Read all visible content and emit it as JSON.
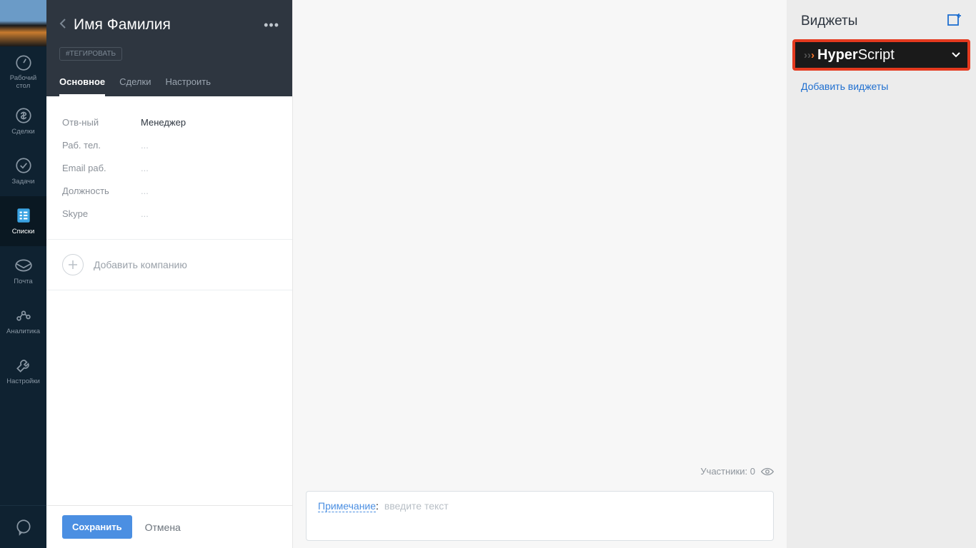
{
  "nav": {
    "items": [
      {
        "label": "Рабочий\nстол",
        "icon": "gauge"
      },
      {
        "label": "Сделки",
        "icon": "dollar"
      },
      {
        "label": "Задачи",
        "icon": "check"
      },
      {
        "label": "Списки",
        "icon": "list"
      },
      {
        "label": "Почта",
        "icon": "mail"
      },
      {
        "label": "Аналитика",
        "icon": "analytics"
      },
      {
        "label": "Настройки",
        "icon": "wrench"
      }
    ]
  },
  "panel": {
    "title": "Имя Фамилия",
    "tag_placeholder": "#ТЕГИРОВАТЬ",
    "tabs": {
      "main": "Основное",
      "deals": "Сделки",
      "setup": "Настроить"
    },
    "fields": [
      {
        "label": "Отв-ный",
        "value": "Менеджер"
      },
      {
        "label": "Раб. тел.",
        "value": "..."
      },
      {
        "label": "Email раб.",
        "value": "..."
      },
      {
        "label": "Должность",
        "value": "..."
      },
      {
        "label": "Skype",
        "value": "..."
      }
    ],
    "add_company": "Добавить компанию",
    "save": "Сохранить",
    "cancel": "Отмена"
  },
  "middle": {
    "participants_label": "Участники: ",
    "participants_count": "0",
    "note_label": "Примечание",
    "note_colon": ": ",
    "note_placeholder": "введите текст"
  },
  "widgets": {
    "title": "Виджеты",
    "hyper_bold": "Hyper",
    "hyper_light": "Script",
    "add_link": "Добавить виджеты"
  }
}
